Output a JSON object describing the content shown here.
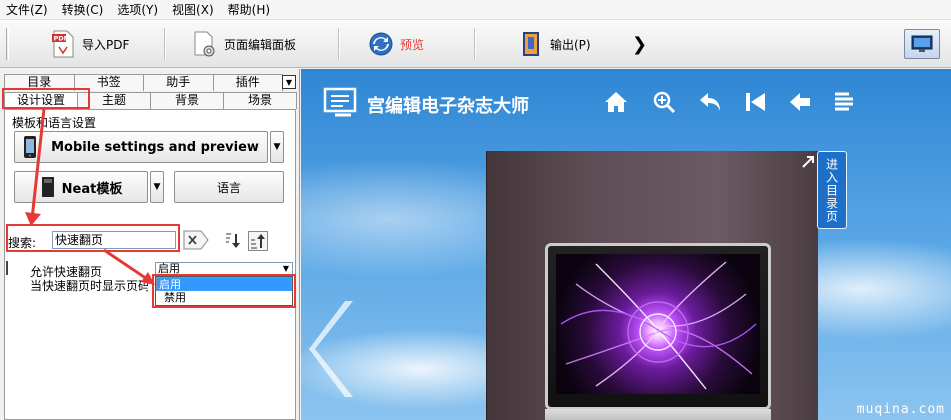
{
  "menubar": {
    "items": [
      "文件(Z)",
      "转换(C)",
      "选项(Y)",
      "视图(X)",
      "帮助(H)"
    ]
  },
  "toolbar": {
    "import_pdf": "导入PDF",
    "page_editor": "页面编辑面板",
    "preview": "预览",
    "output": "输出(P)"
  },
  "tabs": {
    "row1": [
      "目录",
      "书签",
      "助手",
      "插件"
    ],
    "row2": [
      "设计设置",
      "主题",
      "背景",
      "场景"
    ]
  },
  "design": {
    "group_label": "模板和语言设置",
    "mobile_button": "Mobile settings and preview",
    "template_button": "Neat模板",
    "language_button": "语言"
  },
  "search": {
    "label": "搜索:",
    "value": "快速翻页"
  },
  "props": {
    "row1_label": "允许快速翻页",
    "row2_label": "当快速翻页时显示页码",
    "select_value": "启用",
    "options": [
      "启用",
      "禁用"
    ]
  },
  "preview": {
    "brand": "宫编辑电子杂志大师",
    "side_tab": "进入目录页",
    "watermark": "muqina.com"
  },
  "colors": {
    "accent": "#e53935",
    "preview_sky": "#2f86d4",
    "side_tab": "#1d6fc8",
    "preview_label": "#e53935"
  }
}
